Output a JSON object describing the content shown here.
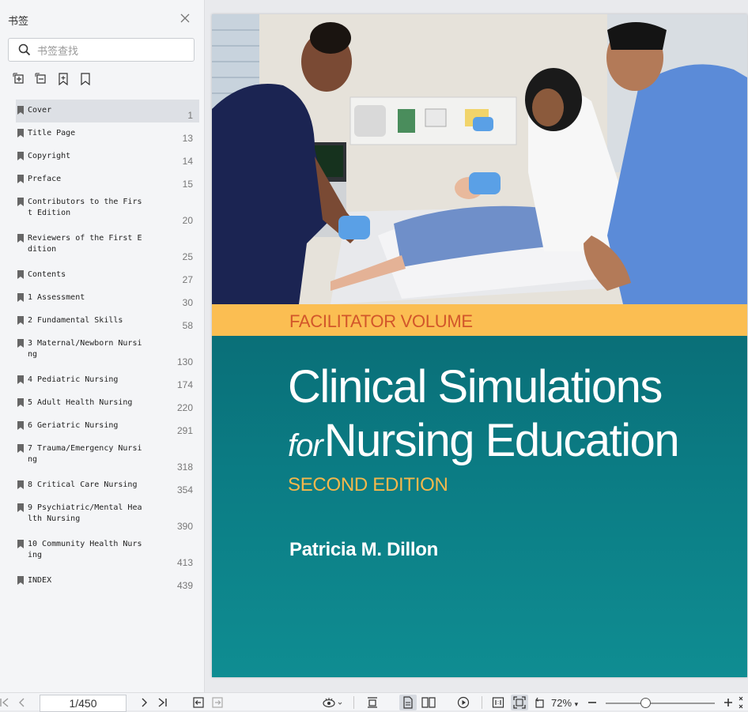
{
  "sidebar": {
    "title": "书签",
    "search_placeholder": "书签查找",
    "bookmarks": [
      {
        "label": "Cover",
        "page": "1"
      },
      {
        "label": "Title Page",
        "page": "13"
      },
      {
        "label": "Copyright",
        "page": "14"
      },
      {
        "label": "Preface",
        "page": "15"
      },
      {
        "label": "Contributors to the First Edition",
        "page": "20"
      },
      {
        "label": "Reviewers of the First Edition",
        "page": "25"
      },
      {
        "label": "Contents",
        "page": "27"
      },
      {
        "label": "1 Assessment",
        "page": "30"
      },
      {
        "label": "2 Fundamental Skills",
        "page": "58"
      },
      {
        "label": "3 Maternal/Newborn Nursing",
        "page": "130"
      },
      {
        "label": "4 Pediatric Nursing",
        "page": "174"
      },
      {
        "label": "5 Adult Health Nursing",
        "page": "220"
      },
      {
        "label": "6 Geriatric Nursing",
        "page": "291"
      },
      {
        "label": "7 Trauma/Emergency Nursing",
        "page": "318"
      },
      {
        "label": "8 Critical Care Nursing",
        "page": "354"
      },
      {
        "label": "9 Psychiatric/Mental Health Nursing",
        "page": "390"
      },
      {
        "label": "10 Community Health Nursing",
        "page": "413"
      },
      {
        "label": "INDEX",
        "page": "439"
      }
    ]
  },
  "cover": {
    "band_text": "FACILITATOR VOLUME",
    "title_line1": "Clinical Simulations",
    "title_for": "for",
    "title_line2": "Nursing Education",
    "edition": "SECOND EDITION",
    "author": "Patricia M. Dillon",
    "colors": {
      "teal": "#0e7b82",
      "band": "#fbbe52",
      "band_text": "#d2562a",
      "edition": "#f6b84b"
    }
  },
  "toolbar": {
    "page_value": "1/450",
    "zoom": "72%"
  }
}
